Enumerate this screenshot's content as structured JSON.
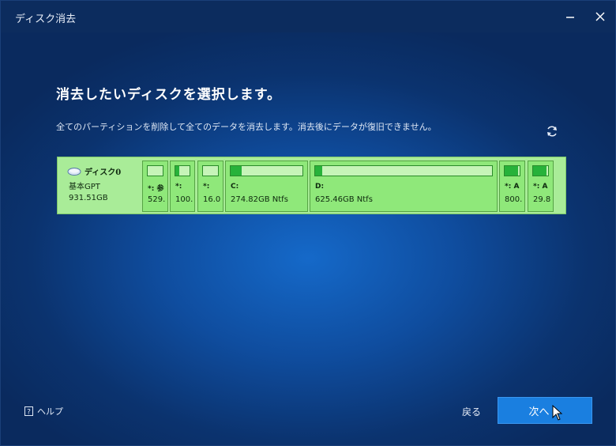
{
  "window": {
    "title": "ディスク消去"
  },
  "main": {
    "headline": "消去したいディスクを選択します。",
    "description": "全てのパーティションを削除して全てのデータを消去します。消去後にデータが復旧できません。"
  },
  "disk": {
    "name": "ディスク0",
    "type": "基本GPT",
    "size": "931.51GB",
    "partitions": [
      {
        "label": "*: 参",
        "size": "529.",
        "used": 0.0
      },
      {
        "label": "*:",
        "size": "100.",
        "used": 0.3
      },
      {
        "label": "*:",
        "size": "16.0",
        "used": 0.0
      },
      {
        "label": "C:",
        "size": "274.82GB Ntfs",
        "used": 0.15
      },
      {
        "label": "D:",
        "size": "625.46GB Ntfs",
        "used": 0.01
      },
      {
        "label": "*: A",
        "size": "800.",
        "used": 0.9
      },
      {
        "label": "*: A",
        "size": "29.8",
        "used": 0.9
      }
    ]
  },
  "footer": {
    "help_label": "ヘルプ",
    "back_label": "戻る",
    "next_label": "次へ >"
  },
  "colors": {
    "accent": "#1a7fe0",
    "partition_fill": "#27b23a"
  }
}
